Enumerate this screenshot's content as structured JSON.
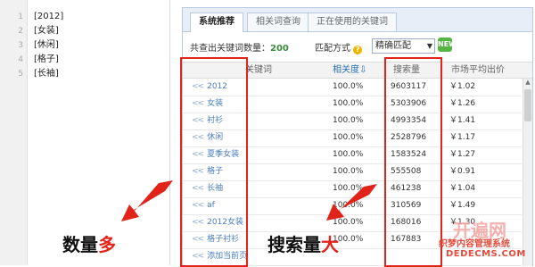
{
  "editor": {
    "lines": [
      {
        "num": "1",
        "text": "[2012]"
      },
      {
        "num": "2",
        "text": "[女装]"
      },
      {
        "num": "3",
        "text": "[休闲]"
      },
      {
        "num": "4",
        "text": "[格子]"
      },
      {
        "num": "5",
        "text": "[长袖]"
      }
    ]
  },
  "tabs": [
    "系统推荐",
    "相关词查询",
    "正在使用的关键词"
  ],
  "stats": {
    "label": "共查出关键词数量：",
    "count": "200"
  },
  "match": {
    "label": "匹配方式",
    "value": "精确匹配"
  },
  "table": {
    "headers": {
      "keyword": "关键词",
      "relevance": "相关度",
      "volume": "搜索量",
      "price": "市场平均出价"
    },
    "rows": [
      {
        "keyword": "2012",
        "relevance": "100.0%",
        "volume": "9603117",
        "price": "￥1.02"
      },
      {
        "keyword": "女装",
        "relevance": "100.0%",
        "volume": "5303906",
        "price": "￥1.26"
      },
      {
        "keyword": "衬衫",
        "relevance": "100.0%",
        "volume": "4993354",
        "price": "￥1.41"
      },
      {
        "keyword": "休闲",
        "relevance": "100.0%",
        "volume": "2528796",
        "price": "￥1.17"
      },
      {
        "keyword": "夏季女装",
        "relevance": "100.0%",
        "volume": "1583524",
        "price": "￥1.27"
      },
      {
        "keyword": "格子",
        "relevance": "100.0%",
        "volume": "555508",
        "price": "￥0.91"
      },
      {
        "keyword": "长袖",
        "relevance": "100.0%",
        "volume": "461238",
        "price": "￥1.04"
      },
      {
        "keyword": "af",
        "relevance": "100.0%",
        "volume": "310569",
        "price": "￥1.49"
      },
      {
        "keyword": "2012女装",
        "relevance": "100.0%",
        "volume": "168016",
        "price": "￥1.30"
      },
      {
        "keyword": "格子衬衫",
        "relevance": "100.0%",
        "volume": "167883",
        "price": ""
      },
      {
        "keyword": "添加当前页",
        "relevance": "",
        "volume": "",
        "price": ""
      }
    ]
  },
  "annotations": {
    "left_label": {
      "black": "数量",
      "red": "多"
    },
    "right_label": {
      "black": "搜索量",
      "red": "大"
    }
  },
  "watermark": {
    "logo": "开遍网",
    "cn": "织梦内容管理系统",
    "en": "DEDECMS.COM"
  },
  "colors": {
    "accent": "#e2231a",
    "link": "#4a7fc0",
    "count": "#3a8c3a"
  }
}
